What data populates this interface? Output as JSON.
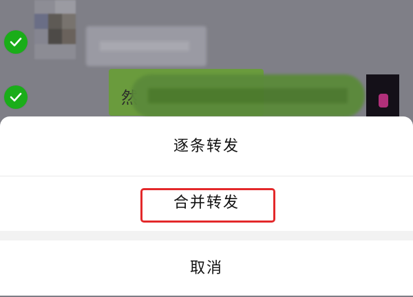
{
  "chat": {
    "bubble_fragment": "然"
  },
  "action_sheet": {
    "forward_one_by_one": "逐条转发",
    "merge_forward": "合并转发",
    "cancel": "取消"
  },
  "colors": {
    "check_green": "#1aad19",
    "highlight_red": "#e3282a",
    "sheet_bg": "#ffffff"
  }
}
